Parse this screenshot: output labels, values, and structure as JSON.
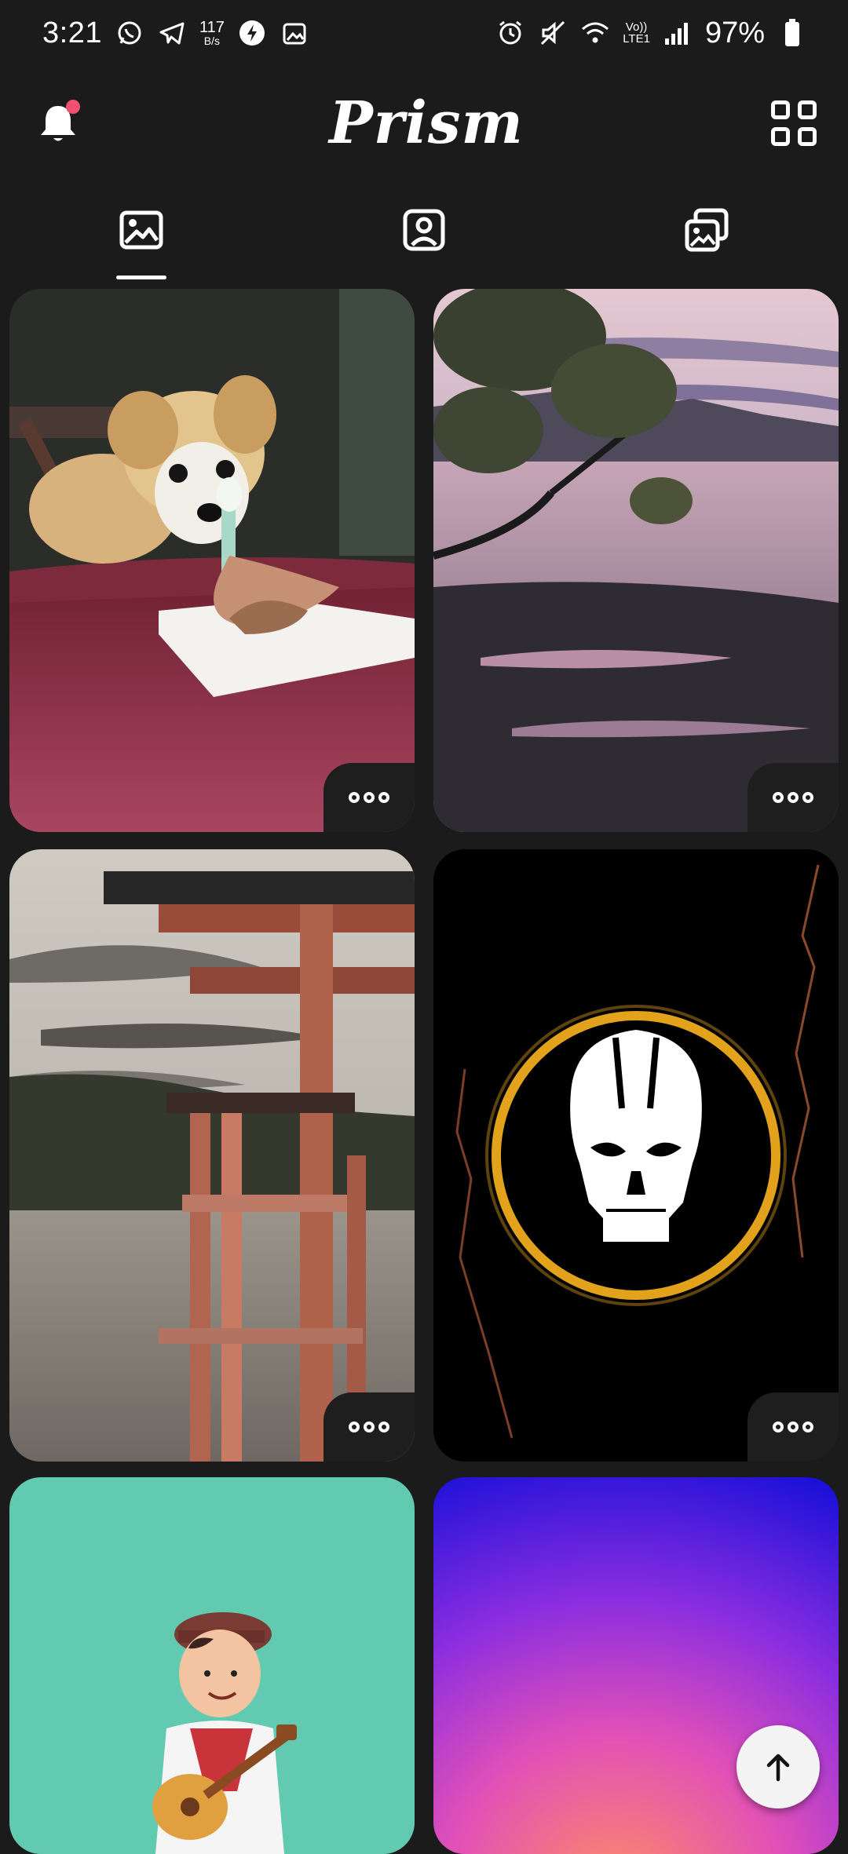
{
  "status_bar": {
    "time": "3:21",
    "net_speed_value": "117",
    "net_speed_unit": "B/s",
    "volte_top": "Vo))",
    "volte_bottom": "LTE1",
    "battery": "97%"
  },
  "app_bar": {
    "title": "Prism",
    "notification_badge": true
  },
  "tabs": [
    {
      "name": "wallpapers",
      "icon": "image-icon",
      "active": true
    },
    {
      "name": "profile",
      "icon": "profile-icon",
      "active": false
    },
    {
      "name": "collections",
      "icon": "collections-icon",
      "active": false
    }
  ],
  "wallpapers": [
    {
      "id": "dog-birthday",
      "more": "•••"
    },
    {
      "id": "lake-tree-sunset",
      "more": "•••"
    },
    {
      "id": "torii-gate-lake",
      "more": "•••"
    },
    {
      "id": "skull-emblem",
      "more": "•••"
    },
    {
      "id": "guitar-man-illustration"
    },
    {
      "id": "purple-gradient"
    }
  ],
  "colors": {
    "background": "#1b1b1b",
    "badge": "#f0506e",
    "skull_ring": "#e3a21b",
    "illustration_bg": "#62cab1"
  }
}
